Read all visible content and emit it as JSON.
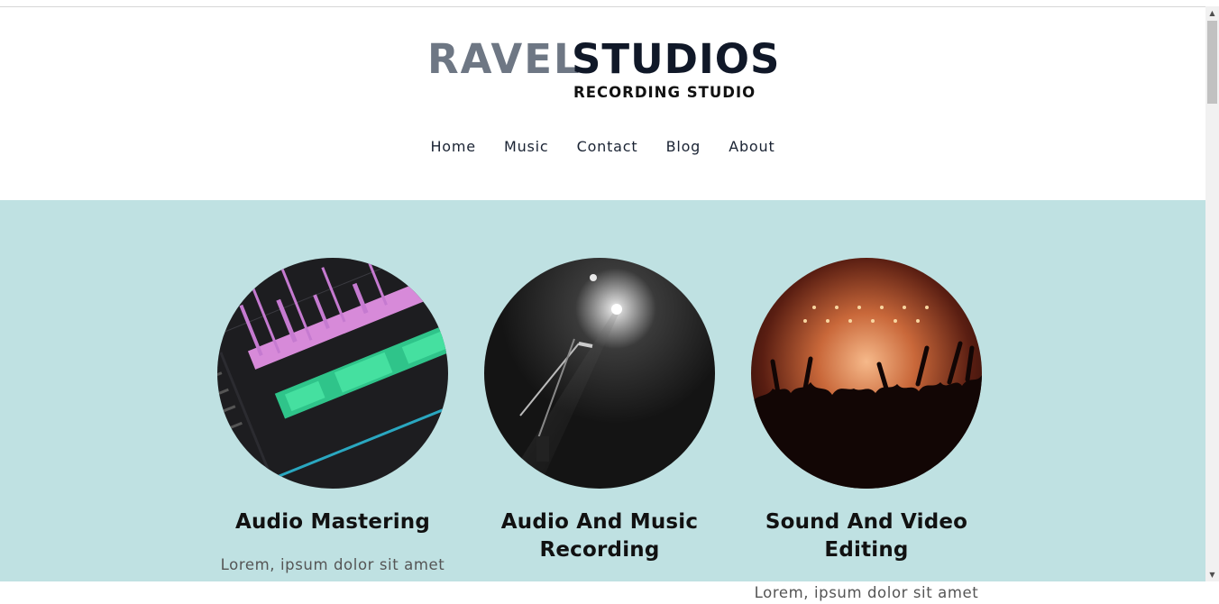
{
  "brand": {
    "name_light": "RAVEL",
    "name_dark": "STUDIOS",
    "tagline": "RECORDING STUDIO",
    "color_light": "#6e7784",
    "color_dark": "#101828"
  },
  "nav": {
    "items": [
      {
        "label": "Home"
      },
      {
        "label": "Music"
      },
      {
        "label": "Contact"
      },
      {
        "label": "Blog"
      },
      {
        "label": "About"
      }
    ]
  },
  "services": {
    "band_color": "#bfe1e2",
    "items": [
      {
        "title": "Audio Mastering",
        "description": "Lorem, ipsum dolor sit amet",
        "image": "daw-waveform-image"
      },
      {
        "title": "Audio And Music Recording",
        "description": "",
        "image": "stage-microphone-image"
      },
      {
        "title": "Sound And Video Editing",
        "description": "Lorem, ipsum dolor sit amet",
        "image": "concert-crowd-image"
      }
    ]
  }
}
